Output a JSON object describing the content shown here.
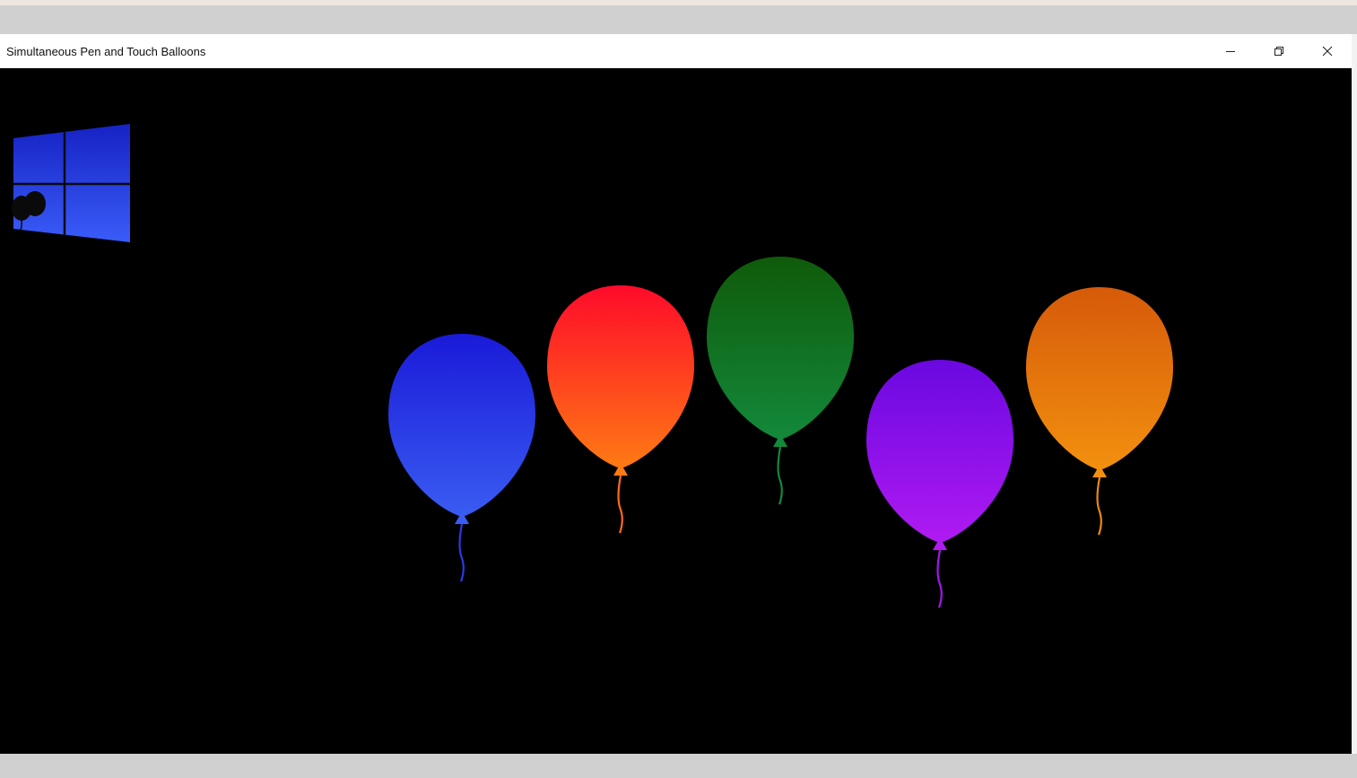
{
  "window": {
    "title": "Simultaneous Pen and Touch Balloons",
    "controls": {
      "minimize_icon": "minimize-icon",
      "restore_icon": "restore-icon",
      "close_icon": "close-icon"
    }
  },
  "app": {
    "logo_icon": "windows-logo-balloons-icon",
    "balloons": [
      {
        "color": "blue",
        "top": "#1a1ad8",
        "bottom": "#3a5cf2",
        "string": "#2a3ae0"
      },
      {
        "color": "red",
        "top": "#ff0a2a",
        "bottom": "#ff7a14",
        "string": "#ff6a20"
      },
      {
        "color": "green",
        "top": "#0f5a0a",
        "bottom": "#13893a",
        "string": "#13893a"
      },
      {
        "color": "purple",
        "top": "#6a08e0",
        "bottom": "#b01af2",
        "string": "#a018e8"
      },
      {
        "color": "orange",
        "top": "#d65a0a",
        "bottom": "#f2900e",
        "string": "#e88a10"
      }
    ]
  }
}
